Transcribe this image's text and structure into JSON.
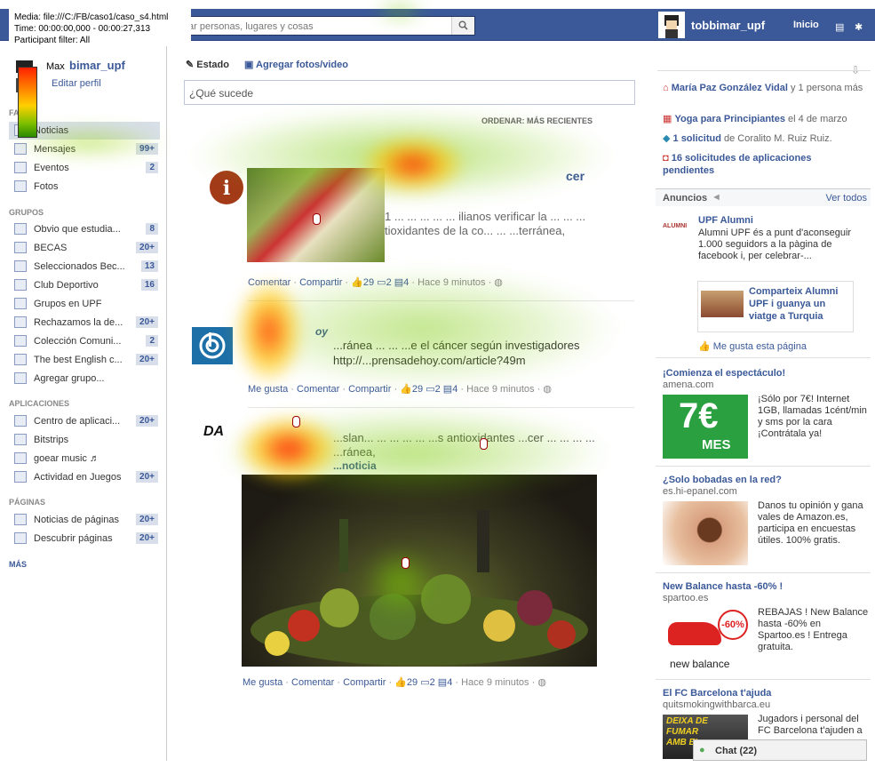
{
  "overlay": {
    "media": "Media: file:///C:/FB/caso1/caso_s4.html",
    "time": "Time: 00:00:00,000 - 00:00:27,313",
    "filter": "Participant filter: All",
    "legend_max": "Max"
  },
  "topbar": {
    "search_placeholder": "ar personas, lugares y cosas",
    "user": "tobbimar_upf",
    "home": "Inicio"
  },
  "profile": {
    "name": "bimar_upf",
    "edit": "Editar perfil"
  },
  "left": {
    "favorites_title": "FA",
    "favorites": [
      {
        "label": "Noticias",
        "count": ""
      },
      {
        "label": "Mensajes",
        "count": "99+"
      },
      {
        "label": "Eventos",
        "count": "2"
      },
      {
        "label": "Fotos",
        "count": ""
      }
    ],
    "groups_title": "GRUPOS",
    "groups": [
      {
        "label": "Obvio que estudia...",
        "count": "8"
      },
      {
        "label": "BECAS",
        "count": "20+"
      },
      {
        "label": "Seleccionados Bec...",
        "count": "13"
      },
      {
        "label": "Club Deportivo",
        "count": "16"
      },
      {
        "label": "Grupos en UPF",
        "count": ""
      },
      {
        "label": "Rechazamos la de...",
        "count": "20+"
      },
      {
        "label": "Colección Comuni...",
        "count": "2"
      },
      {
        "label": "The best English c...",
        "count": "20+"
      },
      {
        "label": "Agregar grupo...",
        "count": ""
      }
    ],
    "apps_title": "APLICACIONES",
    "apps": [
      {
        "label": "Centro de aplicaci...",
        "count": "20+"
      },
      {
        "label": "Bitstrips",
        "count": ""
      },
      {
        "label": "goear music ♬",
        "count": ""
      },
      {
        "label": "Actividad en Juegos",
        "count": "20+"
      }
    ],
    "pages_title": "PÁGINAS",
    "pages": [
      {
        "label": "Noticias de páginas",
        "count": "20+"
      },
      {
        "label": "Descubrir páginas",
        "count": "20+"
      }
    ],
    "more": "MÁS"
  },
  "composer": {
    "status": "Estado",
    "photo": "Agregar fotos/video",
    "placeholder": "¿Qué sucede",
    "sort": "ORDENAR: MÁS RECIENTES"
  },
  "posts": [
    {
      "title": "cer",
      "text": "1 ... ... ... ... ... ilianos verificar la ... ... ... tioxidantes de la co... ... ...terránea,",
      "actions": [
        "Comentar",
        "Compartir"
      ],
      "likes": "29",
      "comments": "2",
      "shares": "4",
      "time": "Hace 9 minutos"
    },
    {
      "title": "oy",
      "text": "...ránea ... ... ...e el cáncer según investigadores",
      "link": "http://...prensadehoy.com/article?49m",
      "actions": [
        "Me gusta",
        "Comentar",
        "Compartir"
      ],
      "likes": "29",
      "comments": "2",
      "shares": "4",
      "time": "Hace 9 minutos"
    },
    {
      "title": "DA",
      "text": "...slan... ... ... ... ... ...s antioxidantes ...cer ... ... ... ... ...ránea,",
      "subtitle": "...noticia",
      "actions": [
        "Me gusta",
        "Comentar",
        "Compartir"
      ],
      "likes": "29",
      "comments": "2",
      "shares": "4",
      "time": "Hace 9 minutos"
    }
  ],
  "right": {
    "requests": [
      {
        "bold": "María Paz González Vidal",
        "rest": " y 1 persona más"
      },
      {
        "bold": "Yoga para Principiantes",
        "rest": " el 4 de marzo"
      },
      {
        "bold": "1 solicitud",
        "rest": " de Coralito M. Ruiz Ruiz."
      },
      {
        "bold": "16 solicitudes de aplicaciones pendientes",
        "rest": ""
      }
    ],
    "ads_title": "Anuncios",
    "see_all": "Ver todos",
    "ad1": {
      "title": "UPF Alumni",
      "text": "Alumni UPF és a punt d'aconseguir 1.000 seguidors a la pàgina de facebook i, per celebrar-...",
      "logo": "ALUMNI",
      "promo": "Comparteix Alumni UPF i guanya un viatge a Turquia",
      "like": "Me gusta esta página"
    },
    "ad2": {
      "title": "¡Comienza el espectáculo!",
      "url": "amena.com",
      "text": "¡Sólo por 7€! Internet 1GB, llamadas 1cént/min y sms por la cara ¡Contrátala ya!",
      "img_big": "7€",
      "img_small": "MES"
    },
    "ad3": {
      "title": "¿Solo bobadas en la red?",
      "url": "es.hi-epanel.com",
      "text": "Danos tu opinión y gana vales de Amazon.es, participa en encuestas útiles. 100% gratis."
    },
    "ad4": {
      "title": "New Balance hasta -60% !",
      "url": "spartoo.es",
      "text": "REBAJAS ! New Balance hasta -60% en Spartoo.es ! Entrega gratuita.",
      "badge": "-60%",
      "brand": "new balance"
    },
    "ad5": {
      "title": "El FC Barcelona t'ajuda",
      "url": "quitsmokingwithbarca.eu",
      "text": "Jugadors i personal del FC Barcelona t'ajuden a",
      "img_text": "DEIXA DE FUMAR AMB EL"
    },
    "chat": "Chat (22)"
  },
  "colors": {
    "fb_blue": "#3b5998",
    "heat_red": "#ff2000",
    "heat_green": "#5ab800"
  }
}
